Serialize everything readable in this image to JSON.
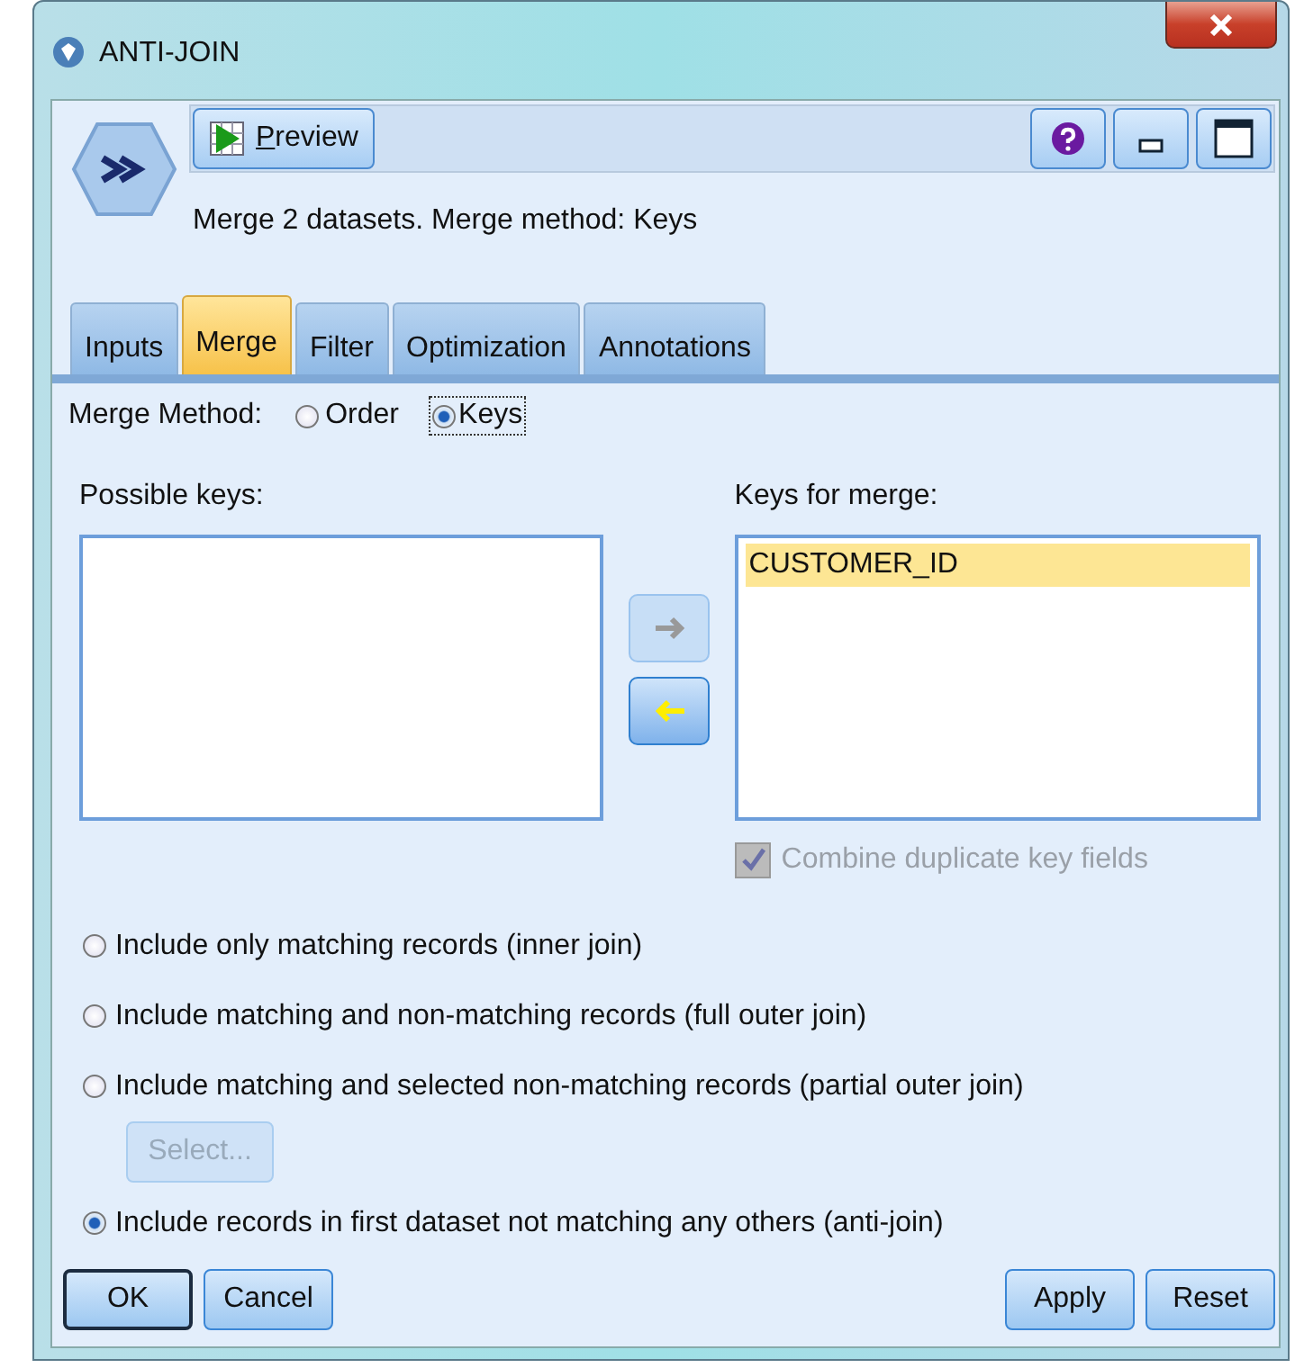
{
  "window": {
    "title": "ANTI-JOIN"
  },
  "header": {
    "preview_button": "Preview",
    "description": "Merge 2 datasets. Merge method: Keys"
  },
  "tabs": [
    {
      "label": "Inputs",
      "selected": false
    },
    {
      "label": "Merge",
      "selected": true
    },
    {
      "label": "Filter",
      "selected": false
    },
    {
      "label": "Optimization",
      "selected": false
    },
    {
      "label": "Annotations",
      "selected": false
    }
  ],
  "merge_method": {
    "label": "Merge Method:",
    "options": [
      {
        "label": "Order",
        "selected": false
      },
      {
        "label": "Keys",
        "selected": true
      }
    ]
  },
  "possible_keys": {
    "label": "Possible keys:"
  },
  "transfer_buttons": [
    {
      "kind": "add",
      "disabled": true
    },
    {
      "kind": "remove",
      "disabled": false
    }
  ],
  "keys_for_merge": {
    "label": "Keys for merge:",
    "items": [
      {
        "label": "CUSTOMER_ID",
        "selected": true
      }
    ]
  },
  "combine_duplicates": {
    "label": "Combine duplicate key fields",
    "checked": true,
    "disabled": true
  },
  "join_options": [
    {
      "label": "Include only matching records (inner join)",
      "selected": false
    },
    {
      "label": "Include matching and non-matching records (full outer join)",
      "selected": false
    },
    {
      "label": "Include matching and selected non-matching records (partial outer join)",
      "selected": false
    },
    {
      "label": "Include records in first dataset not matching any others (anti-join)",
      "selected": true
    }
  ],
  "select_button": {
    "label": "Select...",
    "disabled": true
  },
  "buttons_left": [
    {
      "label": "OK",
      "default": true
    },
    {
      "label": "Cancel",
      "default": false
    }
  ],
  "buttons_right": [
    {
      "label": "Apply",
      "default": false
    },
    {
      "label": "Reset",
      "default": false
    }
  ]
}
